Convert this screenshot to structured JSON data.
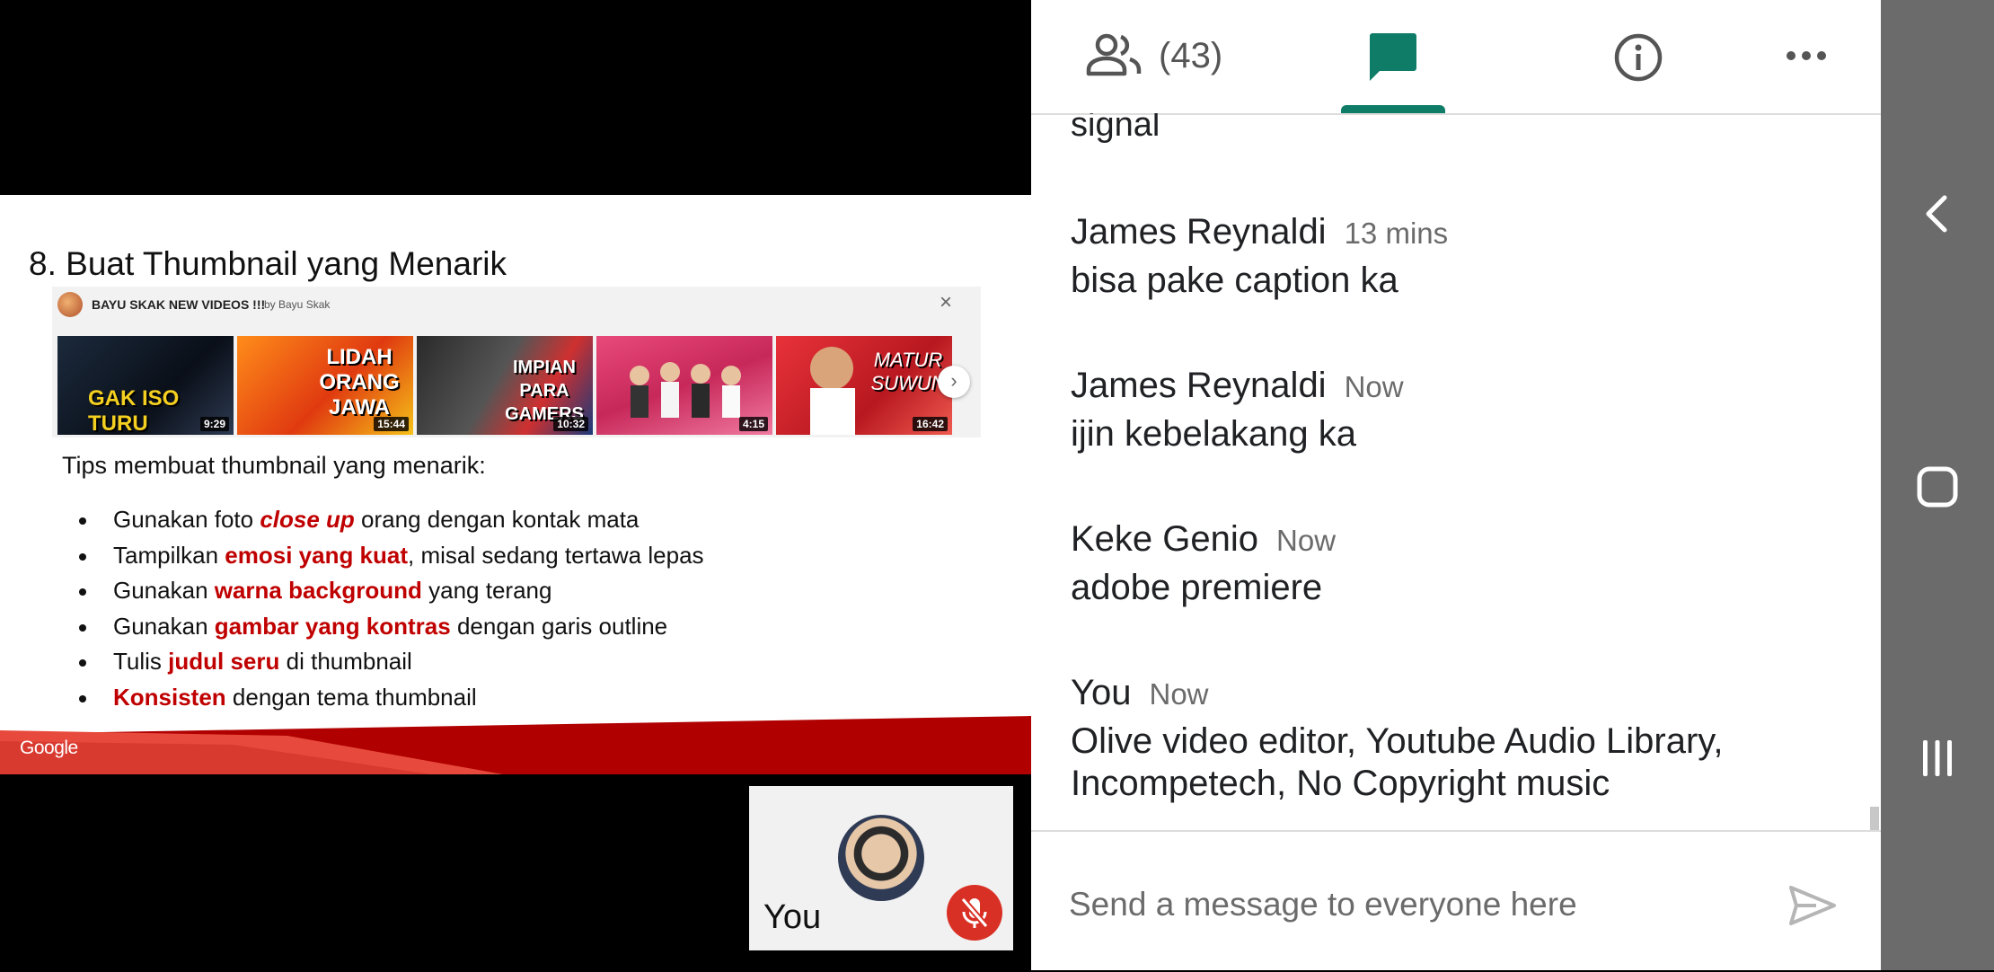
{
  "slide": {
    "title": "8. Buat Thumbnail yang Menarik",
    "youtube_strip": {
      "title": "BAYU SKAK NEW VIDEOS !!!",
      "byline": "by Bayu Skak",
      "close_glyph": "×",
      "next_glyph": "›",
      "thumbnails": [
        {
          "text": "GAK ISO TURU",
          "duration": "9:29"
        },
        {
          "text": "LIDAH ORANG JAWA",
          "duration": "15:44"
        },
        {
          "text": "IMPIAN PARA GAMERS",
          "duration": "10:32"
        },
        {
          "text": "",
          "duration": "4:15"
        },
        {
          "text": "MATUR SUWUN",
          "duration": "16:42"
        }
      ]
    },
    "tips_heading": "Tips membuat thumbnail yang menarik:",
    "tips": [
      {
        "pre": "Gunakan foto ",
        "em": "close up",
        "post": " orang dengan kontak mata"
      },
      {
        "pre": "Tampilkan ",
        "em": "emosi yang kuat",
        "post": ", misal sedang tertawa lepas"
      },
      {
        "pre": "Gunakan ",
        "em": "warna background",
        "post": " yang terang"
      },
      {
        "pre": "Gunakan ",
        "em": "gambar yang kontras",
        "post": " dengan garis outline"
      },
      {
        "pre": "Tulis ",
        "em": "judul seru",
        "post": " di thumbnail"
      },
      {
        "pre": "",
        "em": "Konsisten",
        "post": " dengan tema thumbnail"
      }
    ],
    "footer_brand": "Google"
  },
  "self_view": {
    "label": "You",
    "mic_state": "muted"
  },
  "chat_panel": {
    "tabs": {
      "people_count": "(43)",
      "active_tab": "chat"
    },
    "cutoff_text": "signal",
    "messages": [
      {
        "sender": "James Reynaldi",
        "time": "13 mins",
        "text": "bisa pake caption ka"
      },
      {
        "sender": "James Reynaldi",
        "time": "Now",
        "text": "ijin kebelakang ka"
      },
      {
        "sender": "Keke Genio",
        "time": "Now",
        "text": "adobe premiere"
      },
      {
        "sender": "You",
        "time": "Now",
        "text": "Olive video editor, Youtube Audio Library, Incompetech, No Copyright music"
      }
    ],
    "composer": {
      "placeholder": "Send a message to everyone here",
      "value": ""
    }
  },
  "colors": {
    "accent": "#0e7c66",
    "highlight_red": "#c00000",
    "mic_red": "#d93025",
    "navbar_gray": "#6b6b6b"
  },
  "icons": {
    "people": "people-icon",
    "chat": "chat-icon",
    "info": "info-icon",
    "more": "more-icon",
    "send": "send-icon",
    "mic_off": "mic-off-icon",
    "nav_back": "back-icon",
    "nav_home": "home-icon",
    "nav_recents": "recents-icon"
  }
}
